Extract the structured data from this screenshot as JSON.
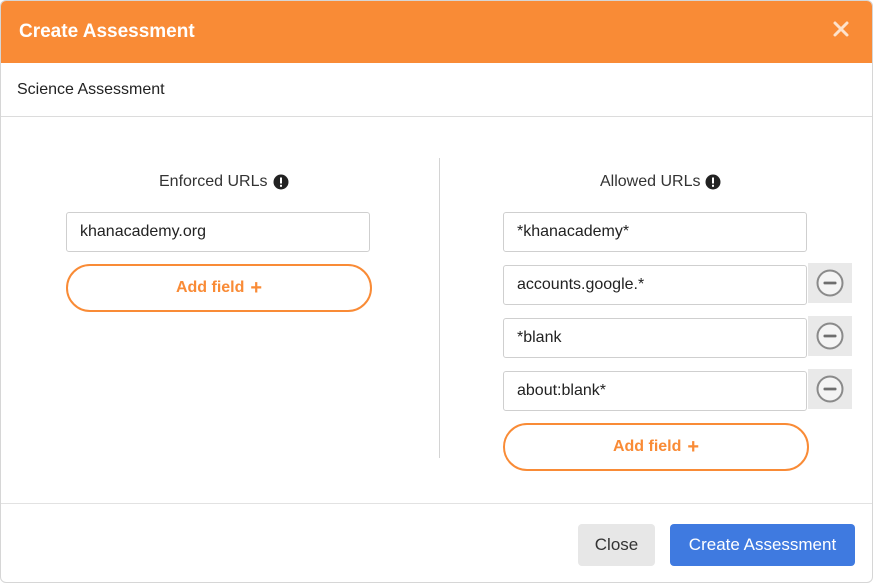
{
  "dialog": {
    "title": "Create Assessment"
  },
  "assessment": {
    "name": "Science Assessment"
  },
  "enforced": {
    "title": "Enforced URLs",
    "fields": [
      "khanacademy.org"
    ],
    "add_label": "Add field"
  },
  "allowed": {
    "title": "Allowed URLs",
    "fields": [
      "*khanacademy*",
      "accounts.google.*",
      "*blank",
      "about:blank*"
    ],
    "add_label": "Add field"
  },
  "footer": {
    "close_label": "Close",
    "create_label": "Create Assessment"
  },
  "colors": {
    "header": "#f98b36",
    "accent": "#f98b36",
    "primary": "#3f7ae0"
  },
  "icons": {
    "close": "close-x-icon",
    "info": "exclamation-circle-icon",
    "add": "plus-icon",
    "remove": "minus-circle-icon"
  }
}
